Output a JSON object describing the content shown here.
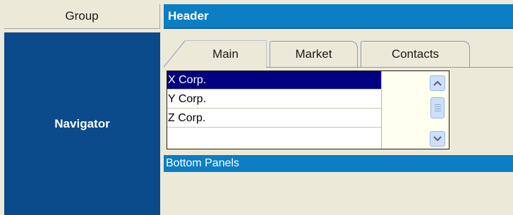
{
  "layout": {
    "group_label": "Group",
    "navigator_label": "Navigator",
    "header_label": "Header",
    "bottom_panels_label": "Bottom Panels"
  },
  "tabs": [
    {
      "label": "Main",
      "active": true
    },
    {
      "label": "Market",
      "active": false
    },
    {
      "label": "Contacts",
      "active": false
    }
  ],
  "list": {
    "items": [
      {
        "label": "X Corp.",
        "selected": true
      },
      {
        "label": "Y Corp.",
        "selected": false
      },
      {
        "label": "Z Corp.",
        "selected": false
      },
      {
        "label": "",
        "selected": false
      }
    ]
  },
  "scrollbar": {
    "up_icon": "chevron-up-icon",
    "down_icon": "chevron-down-icon"
  },
  "colors": {
    "navigator_bg": "#0b4a8b",
    "header_bg": "#0b7ec4",
    "selection_bg": "#000080",
    "window_bg": "#ece9d8"
  }
}
